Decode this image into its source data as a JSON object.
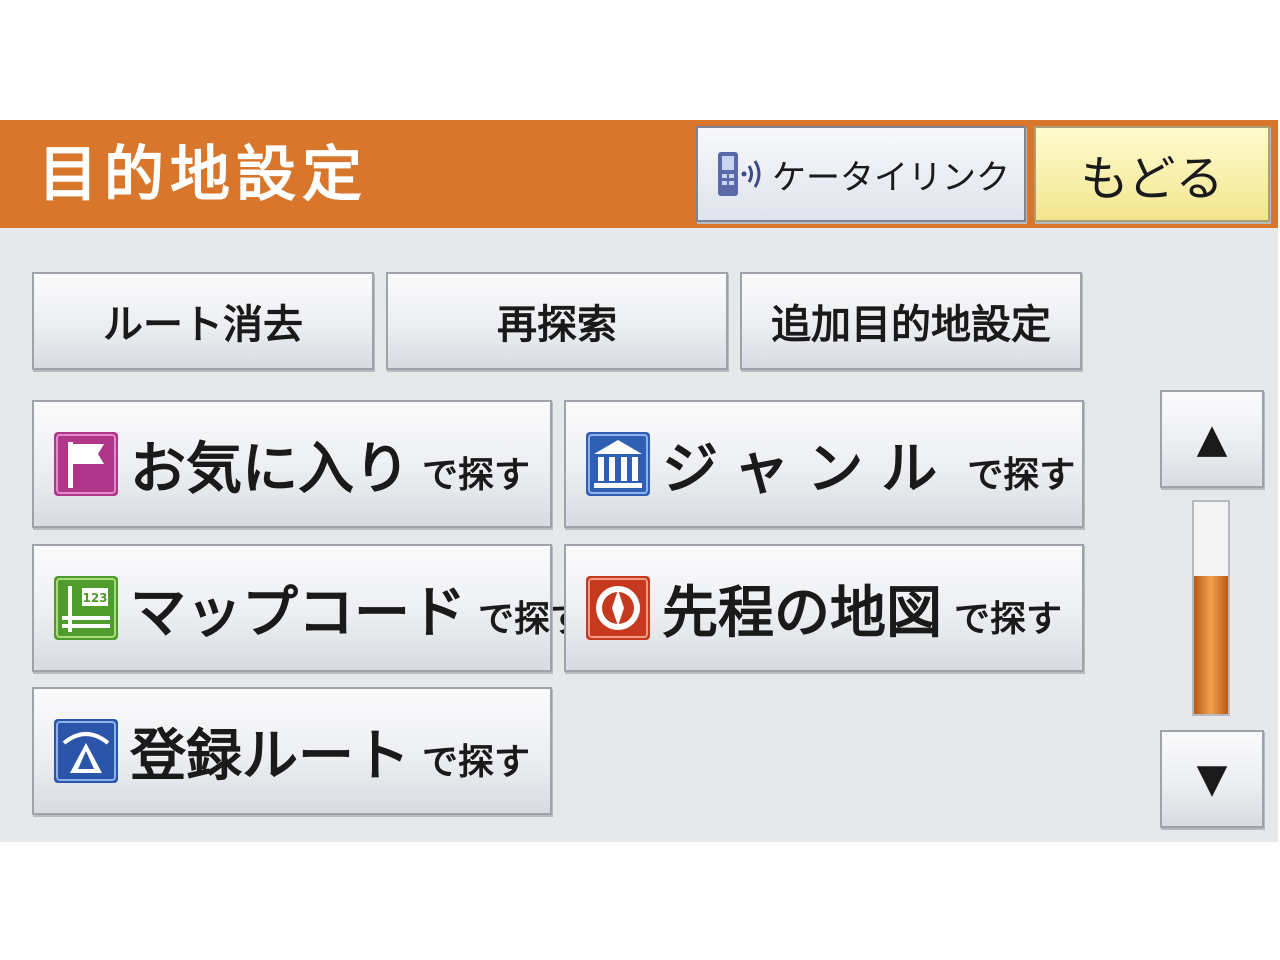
{
  "header": {
    "title": "目的地設定",
    "keitai_link_label": "ケータイリンク",
    "back_label": "もどる"
  },
  "actions": [
    {
      "label": "ルート消去"
    },
    {
      "label": "再探索"
    },
    {
      "label": "追加目的地設定"
    }
  ],
  "search_options": [
    {
      "label": "お気に入り",
      "suffix": "で探す",
      "icon": "flag-icon"
    },
    {
      "label": "ジャンル",
      "suffix": "で探す",
      "icon": "building-icon"
    },
    {
      "label": "マップコード",
      "suffix": "で探す",
      "icon": "mapcode-icon"
    },
    {
      "label": "先程の地図",
      "suffix": "で探す",
      "icon": "previous-map-icon"
    },
    {
      "label": "登録ルート",
      "suffix": "で探す",
      "icon": "registered-route-icon"
    }
  ],
  "scroll": {
    "up_label": "▲",
    "down_label": "▼",
    "fill_fraction": 0.65
  },
  "colors": {
    "header": "#d8772c",
    "background": "#e7e8ea",
    "back_button": "#f2e58f",
    "scroll_fill": "#e07e2a"
  }
}
